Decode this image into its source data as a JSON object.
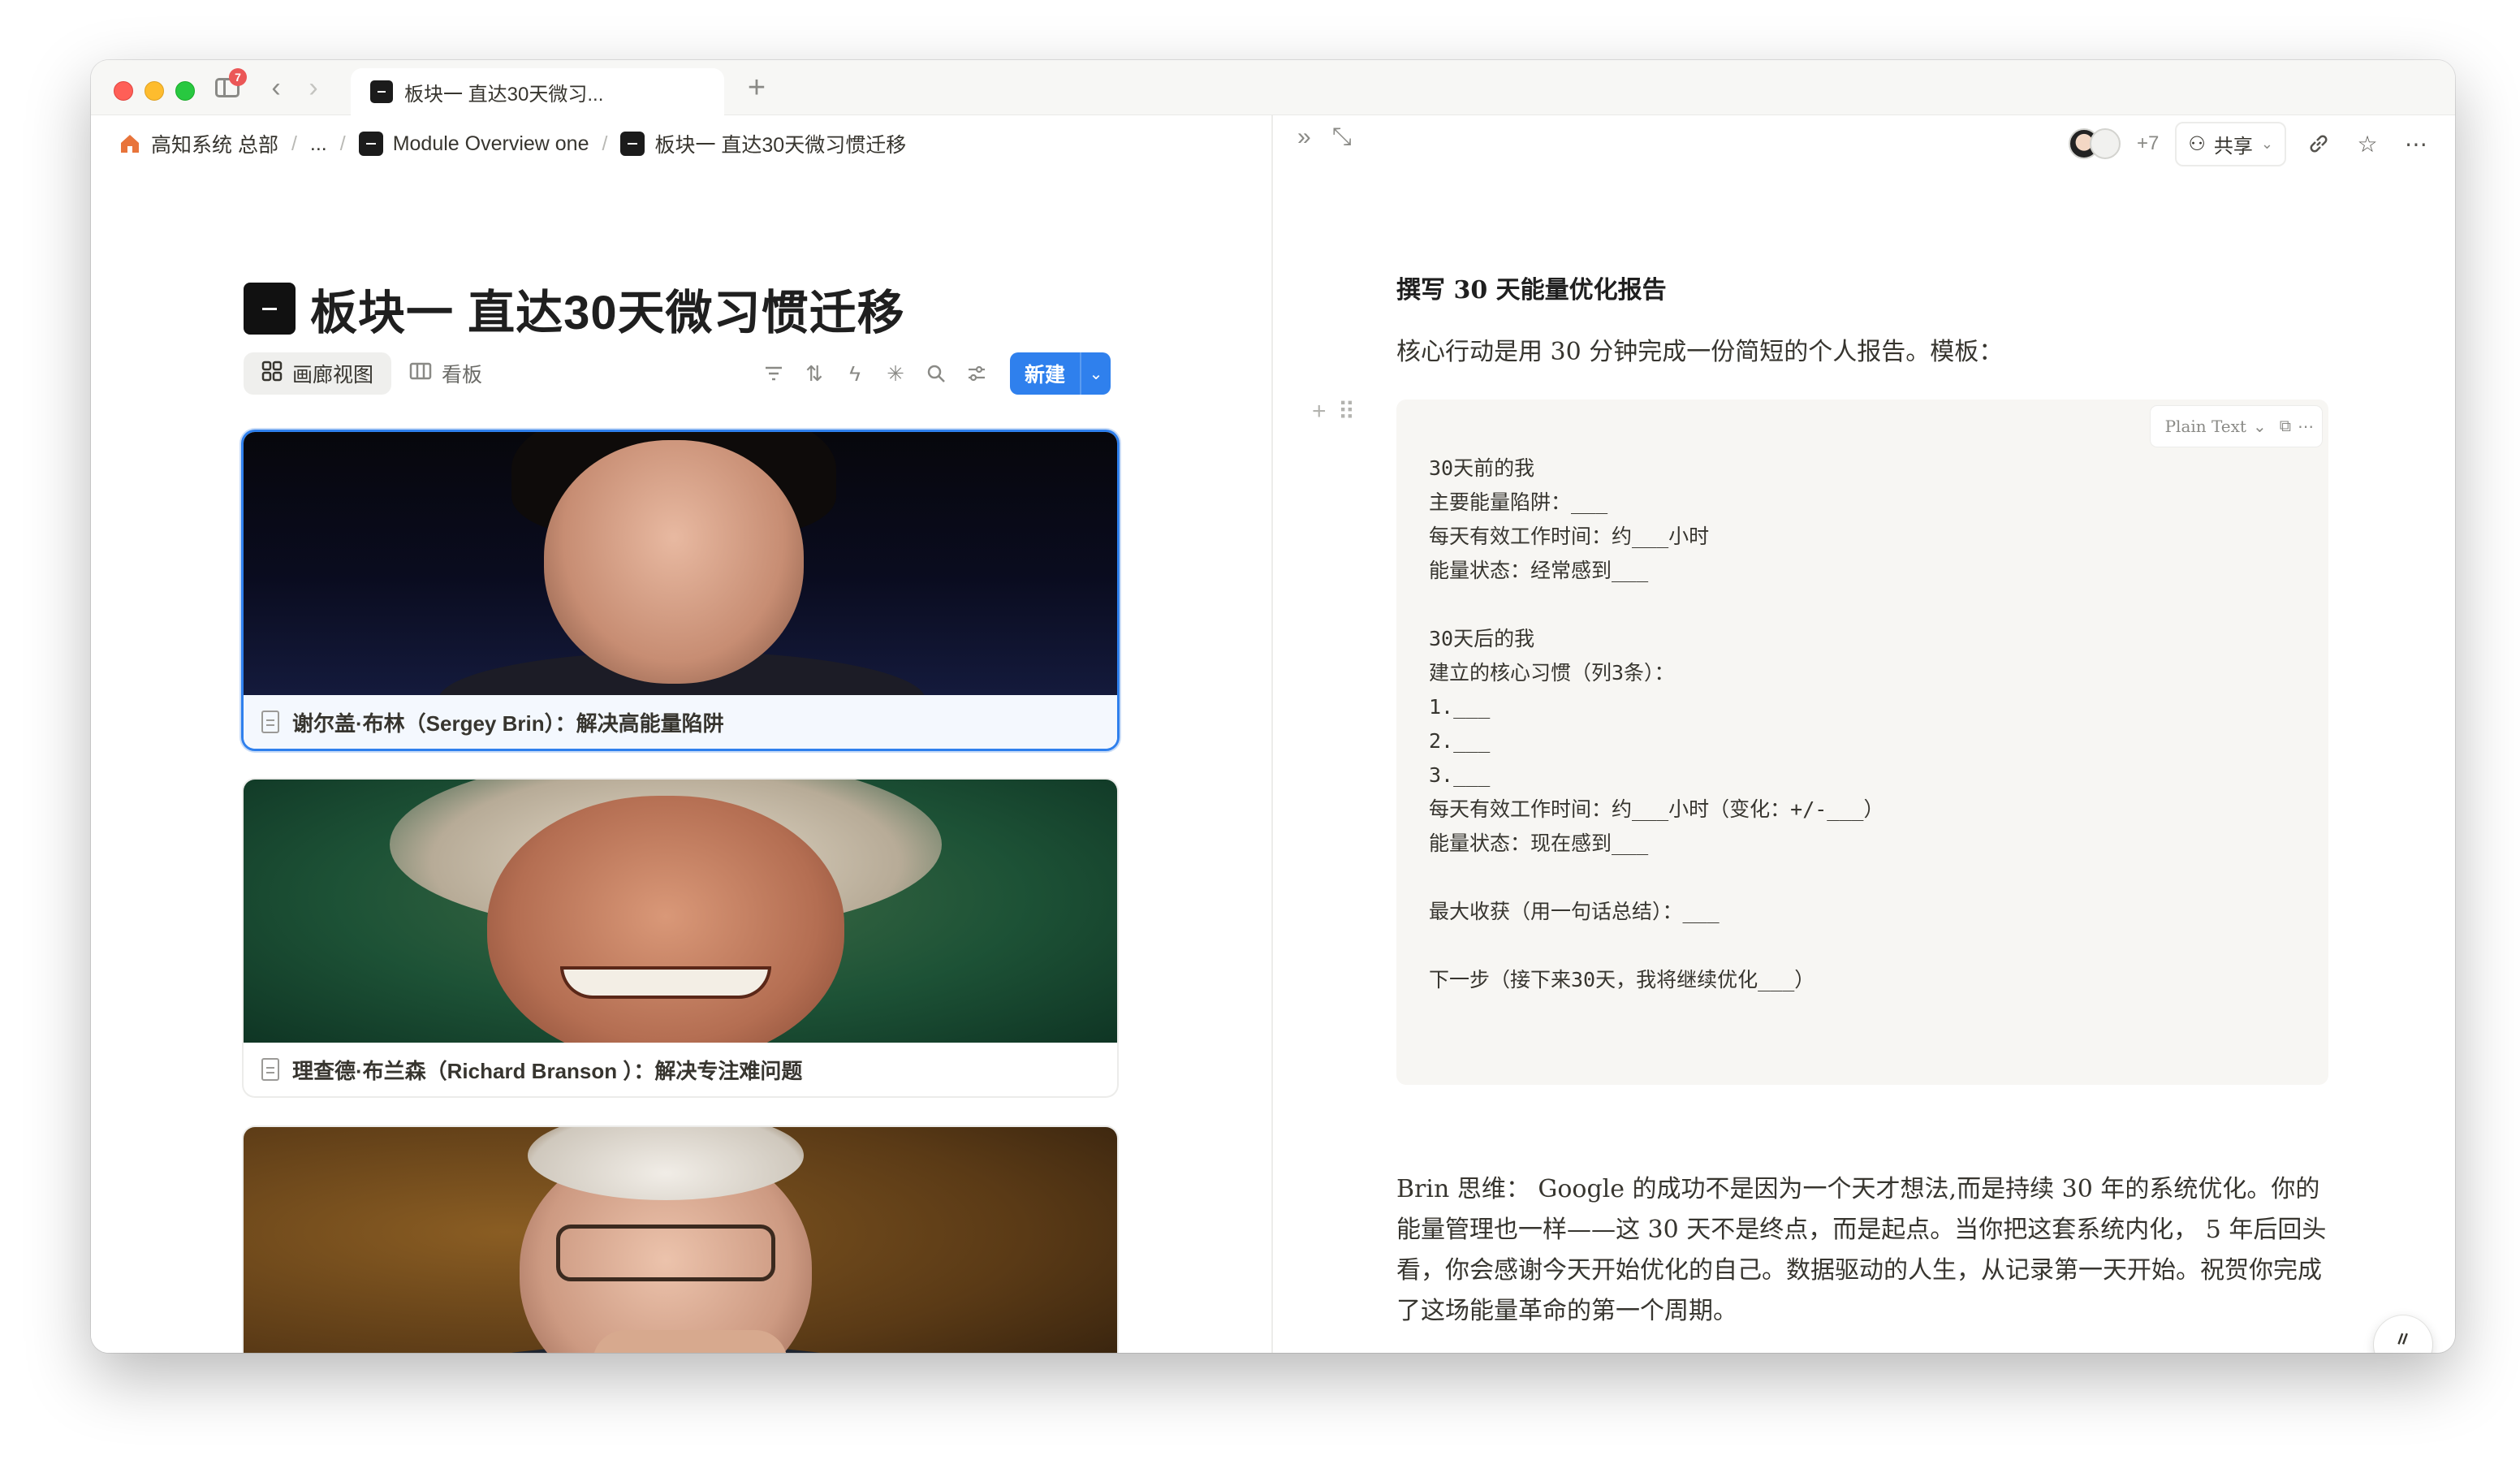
{
  "tab": {
    "title": "板块一 直达30天微习..."
  },
  "titlebar": {
    "notification_count": "7"
  },
  "breadcrumb": {
    "items": [
      "高知系统 总部",
      "...",
      "Module Overview one",
      "板块一 直达30天微习惯迁移"
    ],
    "separator": "/"
  },
  "page": {
    "title": "板块一 直达30天微习惯迁移",
    "views": [
      {
        "label": "画廊视图",
        "icon": "gallery-icon",
        "active": true
      },
      {
        "label": "看板",
        "icon": "board-icon",
        "active": false
      }
    ],
    "new_button": "新建"
  },
  "cards": [
    {
      "title": "谢尔盖·布林（Sergey Brin）：解决高能量陷阱",
      "selected": true
    },
    {
      "title": "理查德·布兰森（Richard Branson ）：解决专注难问题",
      "selected": false
    },
    {
      "title": "",
      "selected": false
    }
  ],
  "right": {
    "collaborators_more": "+7",
    "share_label": "共享",
    "heading": "撰写 30 天能量优化报告",
    "intro": "核心行动是用 30 分钟完成一份简短的个人报告。模板：",
    "code_language": "Plain Text",
    "code_lines": [
      "30天前的我",
      "主要能量陷阱：___",
      "每天有效工作时间：约___小时",
      "能量状态：经常感到___",
      "",
      "30天后的我",
      "建立的核心习惯（列3条）：",
      "1.___",
      "2.___",
      "3.___",
      "每天有效工作时间：约___小时（变化：+/-___）",
      "能量状态：现在感到___",
      "",
      "最大收获（用一句话总结）：___",
      "",
      "下一步（接下来30天，我将继续优化___）"
    ],
    "closing_paragraph": "Brin 思维： Google 的成功不是因为一个天才想法,而是持续 30 年的系统优化。你的能量管理也一样——这 30 天不是终点，而是起点。当你把这套系统内化， 5 年后回头看，你会感谢今天开始优化的自己。数据驱动的人生，从记录第一天开始。祝贺你完成了这场能量革命的第一个周期。"
  },
  "colors": {
    "accent": "#2f80ed",
    "text": "#37352f",
    "code_bg": "#f7f6f3"
  }
}
